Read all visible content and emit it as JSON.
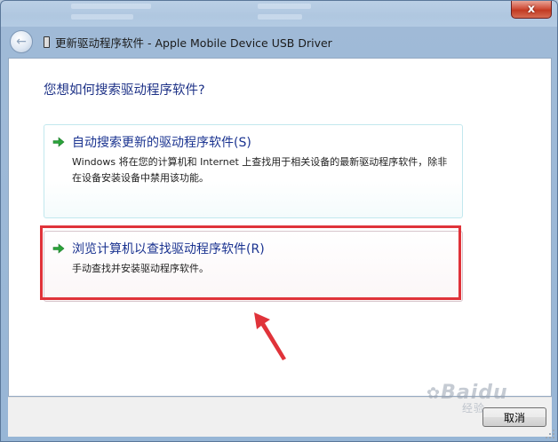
{
  "window": {
    "title": "更新驱动程序软件 - Apple Mobile Device USB Driver",
    "close_label": "x"
  },
  "page": {
    "heading": "您想如何搜索驱动程序软件?"
  },
  "options": [
    {
      "title": "自动搜索更新的驱动程序软件(S)",
      "description": "Windows 将在您的计算机和 Internet 上查找用于相关设备的最新驱动程序软件，除非在设备安装设备中禁用该功能。",
      "icon": "green-arrow-icon"
    },
    {
      "title": "浏览计算机以查找驱动程序软件(R)",
      "description": "手动查找并安装驱动程序软件。",
      "icon": "green-arrow-icon"
    }
  ],
  "footer": {
    "cancel_label": "取消"
  },
  "watermark": {
    "text": "Baidu",
    "subtext": "经验"
  },
  "colors": {
    "heading": "#1e3287",
    "arrow_green": "#2aa33a",
    "highlight_red": "#e0333a",
    "close_red": "#c23a22"
  }
}
